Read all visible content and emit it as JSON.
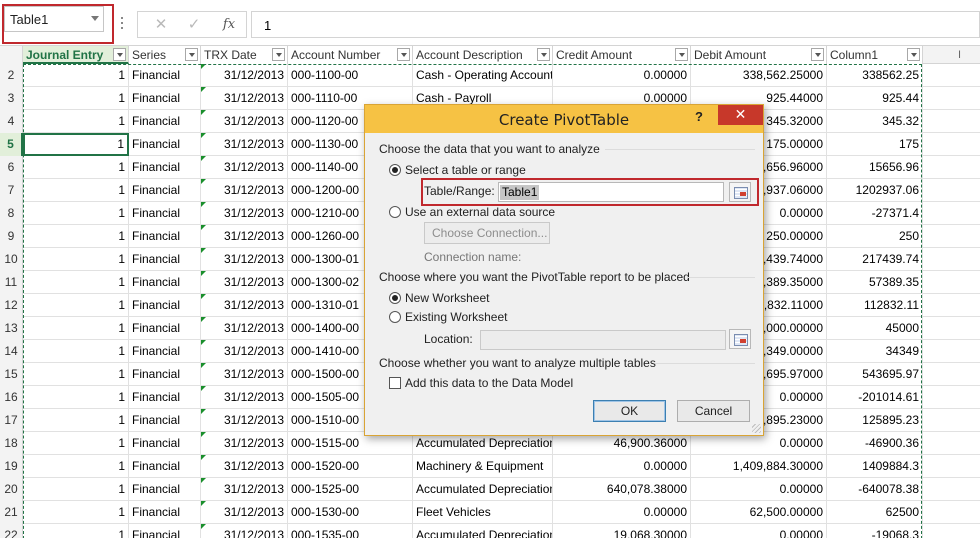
{
  "formula_bar": {
    "name_box": "Table1",
    "cancel_glyph": "✕",
    "enter_glyph": "✓",
    "fx_label": "fx",
    "formula_value": "1"
  },
  "columns": [
    {
      "label": "Journal Entry",
      "active": true
    },
    {
      "label": "Series"
    },
    {
      "label": "TRX Date"
    },
    {
      "label": "Account Number"
    },
    {
      "label": "Account Description"
    },
    {
      "label": "Credit Amount"
    },
    {
      "label": "Debit Amount"
    },
    {
      "label": "Column1"
    }
  ],
  "right_strip_text": "I",
  "rows": [
    {
      "n": "2",
      "je": "1",
      "series": "Financial",
      "date": "31/12/2013",
      "acct": "000-1100-00",
      "desc": "Cash - Operating Account",
      "credit": "0.00000",
      "debit": "338,562.25000",
      "c1": "338562.25"
    },
    {
      "n": "3",
      "je": "1",
      "series": "Financial",
      "date": "31/12/2013",
      "acct": "000-1110-00",
      "desc": "Cash - Payroll",
      "credit": "0.00000",
      "debit": "925.44000",
      "c1": "925.44"
    },
    {
      "n": "4",
      "je": "1",
      "series": "Financial",
      "date": "31/12/2013",
      "acct": "000-1120-00",
      "desc": "",
      "credit": "",
      "debit": "345.32000",
      "c1": "345.32"
    },
    {
      "n": "5",
      "je": "1",
      "series": "Financial",
      "date": "31/12/2013",
      "acct": "000-1130-00",
      "desc": "",
      "credit": "",
      "debit": "175.00000",
      "c1": "175",
      "active": true
    },
    {
      "n": "6",
      "je": "1",
      "series": "Financial",
      "date": "31/12/2013",
      "acct": "000-1140-00",
      "desc": "",
      "credit": "",
      "debit": "5,656.96000",
      "c1": "15656.96"
    },
    {
      "n": "7",
      "je": "1",
      "series": "Financial",
      "date": "31/12/2013",
      "acct": "000-1200-00",
      "desc": "",
      "credit": "",
      "debit": "2,937.06000",
      "c1": "1202937.06"
    },
    {
      "n": "8",
      "je": "1",
      "series": "Financial",
      "date": "31/12/2013",
      "acct": "000-1210-00",
      "desc": "",
      "credit": "",
      "debit": "0.00000",
      "c1": "-27371.4"
    },
    {
      "n": "9",
      "je": "1",
      "series": "Financial",
      "date": "31/12/2013",
      "acct": "000-1260-00",
      "desc": "",
      "credit": "",
      "debit": "250.00000",
      "c1": "250"
    },
    {
      "n": "10",
      "je": "1",
      "series": "Financial",
      "date": "31/12/2013",
      "acct": "000-1300-01",
      "desc": "",
      "credit": "",
      "debit": "7,439.74000",
      "c1": "217439.74"
    },
    {
      "n": "11",
      "je": "1",
      "series": "Financial",
      "date": "31/12/2013",
      "acct": "000-1300-02",
      "desc": "",
      "credit": "",
      "debit": "7,389.35000",
      "c1": "57389.35"
    },
    {
      "n": "12",
      "je": "1",
      "series": "Financial",
      "date": "31/12/2013",
      "acct": "000-1310-01",
      "desc": "",
      "credit": "",
      "debit": "2,832.11000",
      "c1": "112832.11"
    },
    {
      "n": "13",
      "je": "1",
      "series": "Financial",
      "date": "31/12/2013",
      "acct": "000-1400-00",
      "desc": "",
      "credit": "",
      "debit": "5,000.00000",
      "c1": "45000"
    },
    {
      "n": "14",
      "je": "1",
      "series": "Financial",
      "date": "31/12/2013",
      "acct": "000-1410-00",
      "desc": "",
      "credit": "",
      "debit": "4,349.00000",
      "c1": "34349"
    },
    {
      "n": "15",
      "je": "1",
      "series": "Financial",
      "date": "31/12/2013",
      "acct": "000-1500-00",
      "desc": "",
      "credit": "",
      "debit": "3,695.97000",
      "c1": "543695.97"
    },
    {
      "n": "16",
      "je": "1",
      "series": "Financial",
      "date": "31/12/2013",
      "acct": "000-1505-00",
      "desc": "",
      "credit": "",
      "debit": "0.00000",
      "c1": "-201014.61"
    },
    {
      "n": "17",
      "je": "1",
      "series": "Financial",
      "date": "31/12/2013",
      "acct": "000-1510-00",
      "desc": "",
      "credit": "",
      "debit": "5,895.23000",
      "c1": "125895.23"
    },
    {
      "n": "18",
      "je": "1",
      "series": "Financial",
      "date": "31/12/2013",
      "acct": "000-1515-00",
      "desc": "Accumulated Depreciation",
      "credit": "46,900.36000",
      "debit": "0.00000",
      "c1": "-46900.36"
    },
    {
      "n": "19",
      "je": "1",
      "series": "Financial",
      "date": "31/12/2013",
      "acct": "000-1520-00",
      "desc": "Machinery & Equipment",
      "credit": "0.00000",
      "debit": "1,409,884.30000",
      "c1": "1409884.3"
    },
    {
      "n": "20",
      "je": "1",
      "series": "Financial",
      "date": "31/12/2013",
      "acct": "000-1525-00",
      "desc": "Accumulated Depreciation",
      "credit": "640,078.38000",
      "debit": "0.00000",
      "c1": "-640078.38"
    },
    {
      "n": "21",
      "je": "1",
      "series": "Financial",
      "date": "31/12/2013",
      "acct": "000-1530-00",
      "desc": "Fleet Vehicles",
      "credit": "0.00000",
      "debit": "62,500.00000",
      "c1": "62500"
    },
    {
      "n": "22",
      "je": "1",
      "series": "Financial",
      "date": "31/12/2013",
      "acct": "000-1535-00",
      "desc": "Accumulated Depreciation",
      "credit": "19,068.30000",
      "debit": "0.00000",
      "c1": "-19068.3"
    }
  ],
  "dialog": {
    "title": "Create PivotTable",
    "help": "?",
    "close": "✕",
    "section1": "Choose the data that you want to analyze",
    "opt_table": "Select a table or range",
    "range_label": "Table/Range:",
    "range_value": "Table1",
    "opt_external": "Use an external data source",
    "choose_connection": "Choose Connection...",
    "connection_name": "Connection name:",
    "section2": "Choose where you want the PivotTable report to be placed",
    "opt_new": "New Worksheet",
    "opt_existing": "Existing Worksheet",
    "location_label": "Location:",
    "location_value": "",
    "section3": "Choose whether you want to analyze multiple tables",
    "add_data_model": "Add this data to the Data Model",
    "ok": "OK",
    "cancel": "Cancel"
  },
  "colors": {
    "accent_green": "#217346",
    "dialog_title": "#f6c244",
    "close_red": "#c7382a",
    "highlight_red": "#c0282d"
  }
}
